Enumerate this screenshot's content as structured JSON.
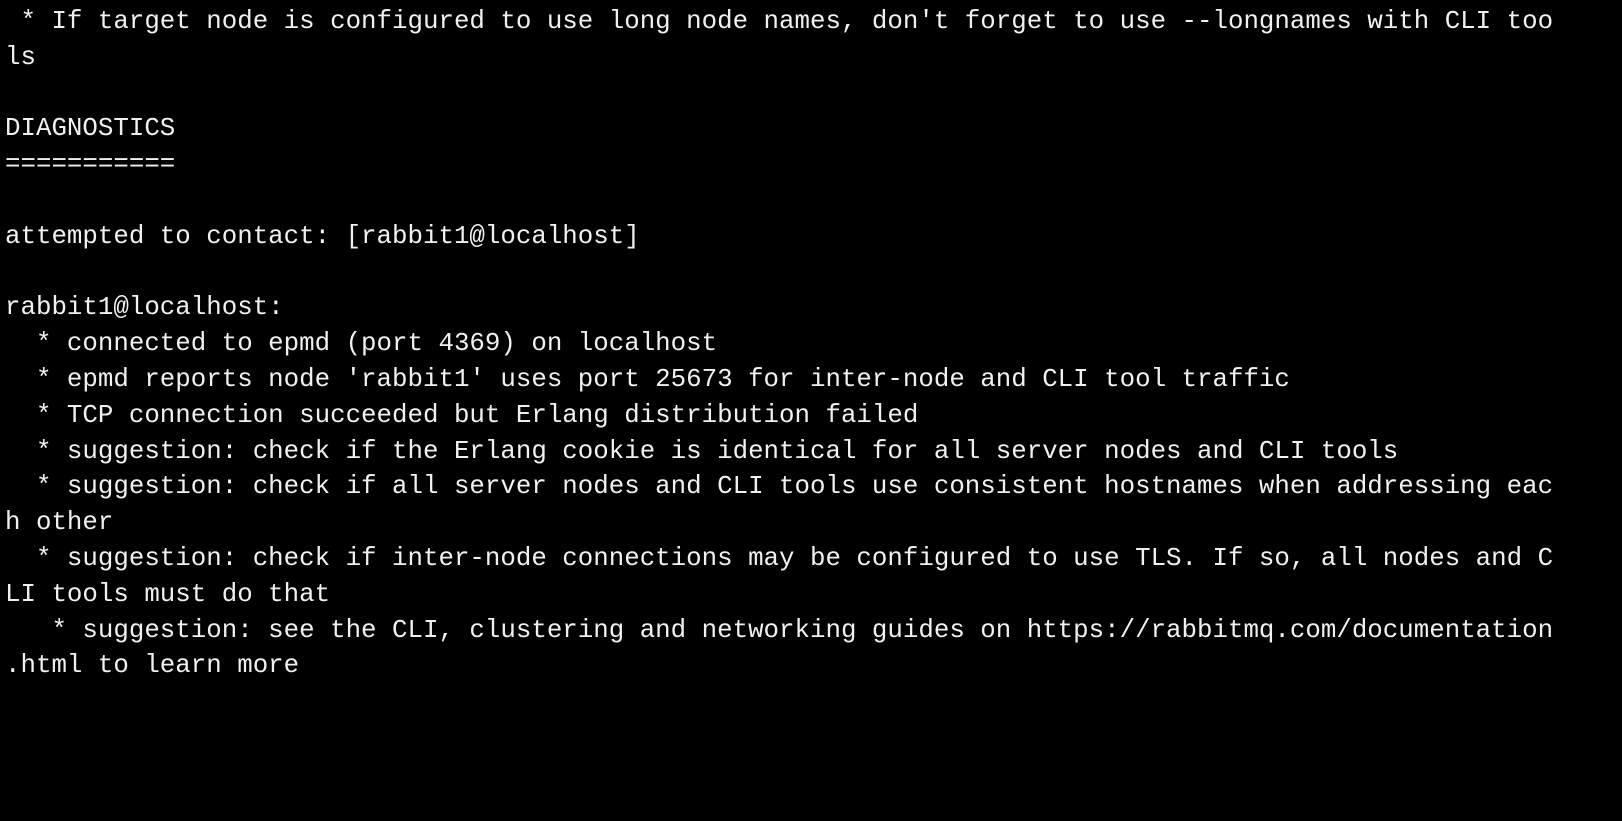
{
  "terminal": {
    "lines": [
      " * If target node is configured to use long node names, don't forget to use --longnames with CLI too",
      "ls",
      "",
      "DIAGNOSTICS",
      "===========",
      "",
      "attempted to contact: [rabbit1@localhost]",
      "",
      "rabbit1@localhost:",
      "  * connected to epmd (port 4369) on localhost",
      "  * epmd reports node 'rabbit1' uses port 25673 for inter-node and CLI tool traffic",
      "  * TCP connection succeeded but Erlang distribution failed",
      "  * suggestion: check if the Erlang cookie is identical for all server nodes and CLI tools",
      "  * suggestion: check if all server nodes and CLI tools use consistent hostnames when addressing eac",
      "h other",
      "  * suggestion: check if inter-node connections may be configured to use TLS. If so, all nodes and C",
      "LI tools must do that",
      "   * suggestion: see the CLI, clustering and networking guides on https://rabbitmq.com/documentation",
      ".html to learn more"
    ]
  }
}
